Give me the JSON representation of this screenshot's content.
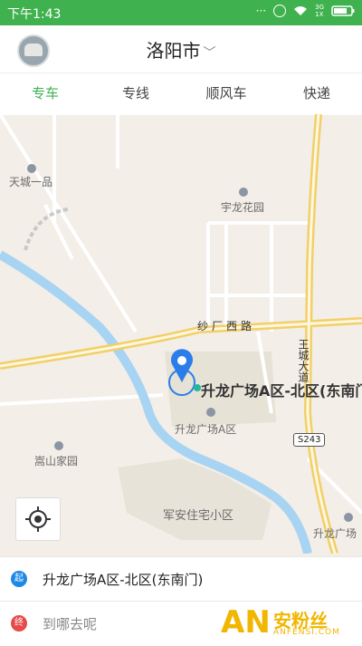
{
  "status": {
    "time": "下午1:43",
    "net_top": "3G",
    "net_bottom": "1X"
  },
  "header": {
    "city": "洛阳市"
  },
  "tabs": [
    "专车",
    "专线",
    "顺风车",
    "快递"
  ],
  "map": {
    "labels": {
      "tiancheng": "天城一品",
      "yulong": "宇龙花园",
      "road": "纱厂西路",
      "wangcheng": "王城大道",
      "shenglong": "升龙广场A区",
      "songshan": "嵩山家园",
      "junan": "军安住宅小区",
      "shenglong_b": "升龙广场",
      "shield": "S243"
    },
    "pin_label": "升龙广场A区-北区(东南门"
  },
  "panel": {
    "start_badge": "起",
    "start_text": "升龙广场A区-北区(东南门)",
    "end_badge": "终",
    "end_placeholder": "到哪去呢"
  },
  "watermark": {
    "main": "安粉丝",
    "sub": "ANFENSI.COM",
    "logo": "AN"
  },
  "colors": {
    "accent": "#3fb24f",
    "start": "#1e88e5",
    "end": "#e64a4a",
    "pin": "#2b7de9"
  }
}
